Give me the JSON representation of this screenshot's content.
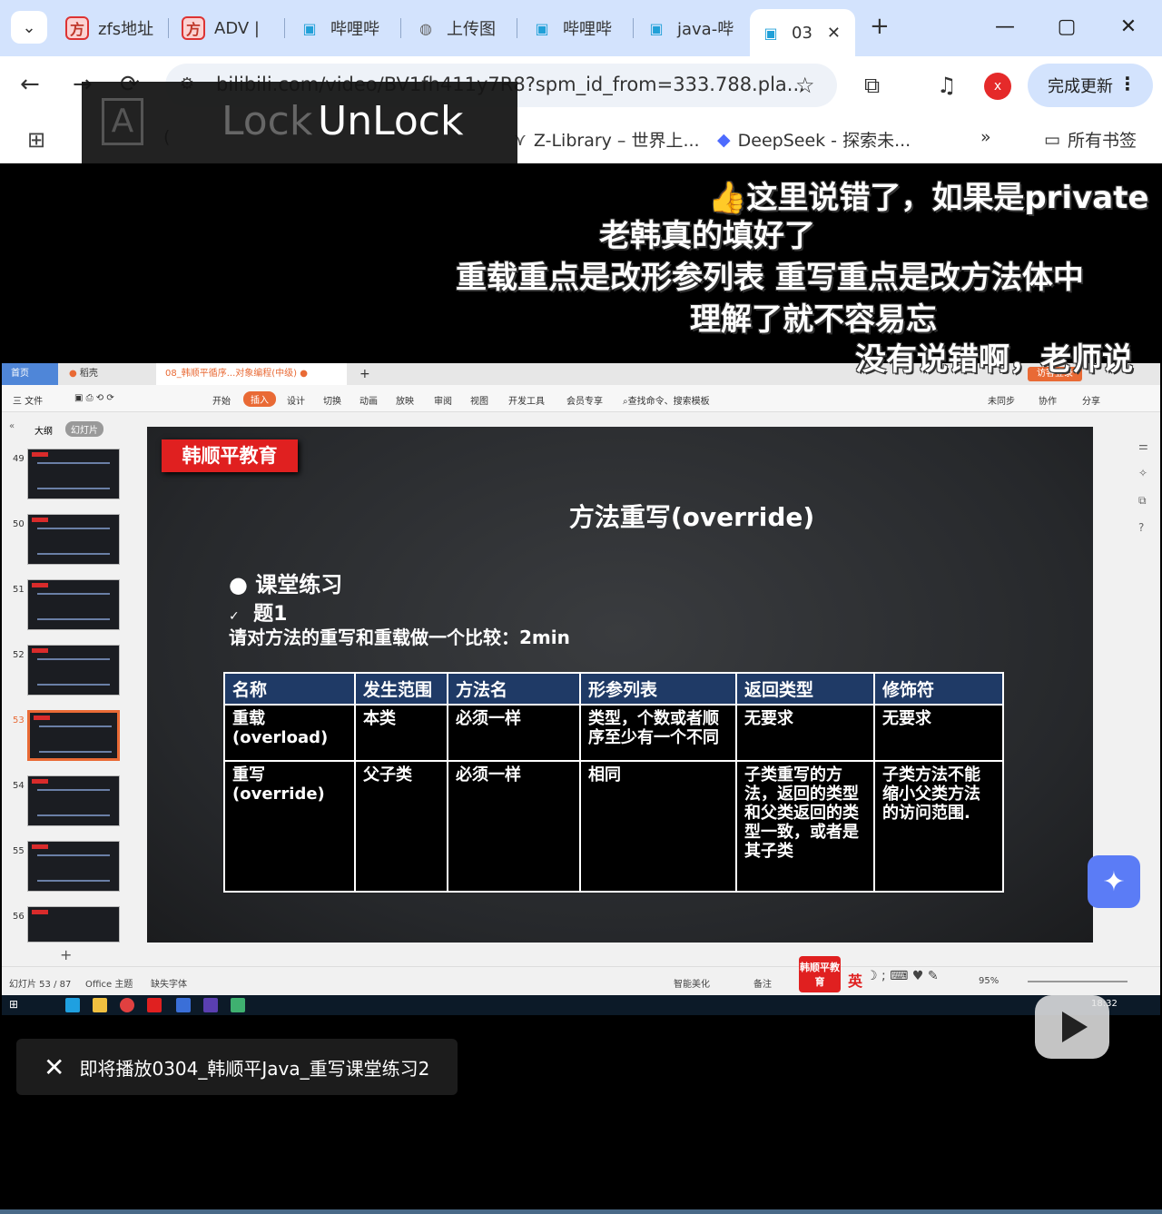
{
  "browser": {
    "tabs": [
      {
        "label": "zfs地址",
        "icon": "fang-icon"
      },
      {
        "label": "ADV |",
        "icon": "fang-icon"
      },
      {
        "label": "哔哩哔",
        "icon": "bilibili-icon"
      },
      {
        "label": "上传图",
        "icon": "globe-icon"
      },
      {
        "label": "哔哩哔",
        "icon": "bilibili-icon"
      },
      {
        "label": "java-哔",
        "icon": "bilibili-icon"
      },
      {
        "label": "03",
        "icon": "bilibili-icon",
        "active": true
      }
    ],
    "url": "bilibili.com/video/BV1fh411y7R8?spm_id_from=333.788.pla...",
    "update_button": "完成更新",
    "extension_badge": "x",
    "bookmarks": [
      "(",
      "Z-Library – 世界上...",
      "DeepSeek - 探索未...",
      "所有书签"
    ]
  },
  "lock_overlay": {
    "lock": "Lock",
    "unlock": "UnLock"
  },
  "danmaku": [
    "这里说错了，如果是private",
    "老韩真的填好了",
    "重载重点是改形参列表  重写重点是改方法体中",
    "理解了就不容易忘",
    "没有说错啊，老师说"
  ],
  "wps": {
    "tabs": [
      "首页",
      "稻壳",
      "08_韩顺平循序...对象编程(中级)"
    ],
    "guest": "访客登录",
    "ribbon": [
      "三 文件",
      "开始",
      "插入",
      "设计",
      "切换",
      "动画",
      "放映",
      "审阅",
      "视图",
      "开发工具",
      "会员专享",
      "查找命令、搜索模板"
    ],
    "ribbon_right": [
      "未同步",
      "协作",
      "分享"
    ],
    "panel_tabs": [
      "大纲",
      "幻灯片"
    ],
    "slide_numbers": [
      "49",
      "50",
      "51",
      "52",
      "53",
      "54",
      "55",
      "56"
    ],
    "status": {
      "slide_pos": "幻灯片 53 / 87",
      "theme": "Office 主题",
      "font": "缺失字体",
      "beautify": "智能美化",
      "notes": "备注",
      "zoom": "95%",
      "brand": "韩顺平教育",
      "ime": "英"
    },
    "taskbar_time": "18:32"
  },
  "slide": {
    "brand": "韩顺平教育",
    "title": "方法重写(override)",
    "bullet": "课堂练习",
    "sub": "题1",
    "question": "请对方法的重写和重载做一个比较：2min",
    "table": {
      "headers": [
        "名称",
        "发生范围",
        "方法名",
        "形参列表",
        "返回类型",
        "修饰符"
      ],
      "rows": [
        [
          "重载(overload)",
          "本类",
          "必须一样",
          "类型，个数或者顺序至少有一个不同",
          "无要求",
          "无要求"
        ],
        [
          "重写(override)",
          "父子类",
          "必须一样",
          "相同",
          "子类重写的方法，返回的类型和父类返回的类型一致，或者是其子类",
          "子类方法不能缩小父类方法的访问范围."
        ]
      ]
    }
  },
  "player": {
    "next_up": "即将播放0304_韩顺平Java_重写课堂练习2"
  },
  "colors": {
    "accent": "#e96a35",
    "brand_red": "#e02020",
    "table_header": "#1f3a66",
    "tabbar": "#d3e3fd"
  }
}
